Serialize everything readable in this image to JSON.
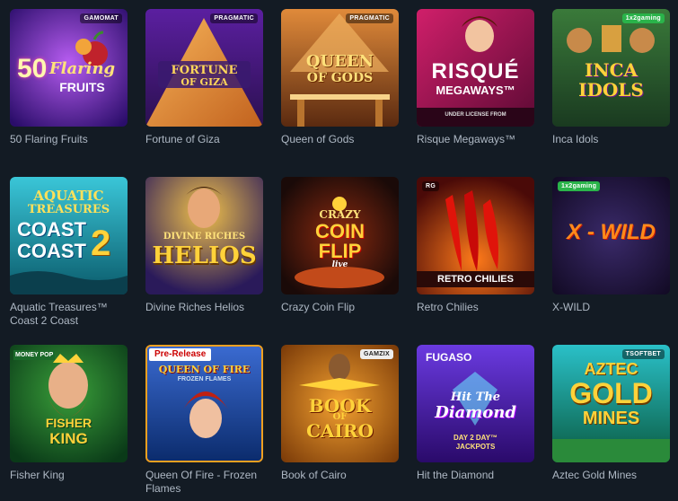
{
  "games": [
    {
      "title": "50 Flaring Fruits",
      "art_text": [
        "50",
        "Flaring",
        "FRUITS"
      ],
      "provider": "GAMOMAT",
      "icon": "fruit-icon"
    },
    {
      "title": "Fortune of Giza",
      "art_text": [
        "FORTUNE",
        "OF GIZA"
      ],
      "provider": "PRAGMATIC",
      "icon": "pyramid-icon"
    },
    {
      "title": "Queen of Gods",
      "art_text": [
        "QUEEN",
        "OF GODS"
      ],
      "provider": "PRAGMATIC",
      "icon": "temple-icon"
    },
    {
      "title": "Risque Megaways™",
      "art_text": [
        "RISQUÉ",
        "MEGAWAYS™",
        "UNDER LICENSE FROM"
      ],
      "provider": "",
      "icon": "dancer-icon"
    },
    {
      "title": "Inca Idols",
      "art_text": [
        "INCA",
        "IDOLS"
      ],
      "provider": "1x2gaming",
      "icon": "idol-icon"
    },
    {
      "title": "Aquatic Treasures™ Coast 2 Coast",
      "art_text": [
        "AQUATIC",
        "TREASURES",
        "COAST",
        "COAST",
        "2"
      ],
      "provider": "",
      "icon": "wave-icon"
    },
    {
      "title": "Divine Riches Helios",
      "art_text": [
        "DIVINE RICHES",
        "HELIOS"
      ],
      "provider": "",
      "icon": "sun-god-icon"
    },
    {
      "title": "Crazy Coin Flip",
      "art_text": [
        "CRAZY",
        "COIN",
        "FLIP",
        "live"
      ],
      "provider": "",
      "icon": "coin-icon"
    },
    {
      "title": "Retro Chilies",
      "art_text": [
        "RETRO CHILIES"
      ],
      "provider": "RG",
      "icon": "chili-icon"
    },
    {
      "title": "X-WILD",
      "art_text": [
        "X - WILD"
      ],
      "provider": "1x2gaming",
      "icon": "x-icon"
    },
    {
      "title": "Fisher King",
      "art_text": [
        "FISHER",
        "KING",
        "MONEY POP"
      ],
      "provider": "",
      "icon": "king-icon"
    },
    {
      "title": "Queen Of Fire - Frozen Flames",
      "art_text": [
        "Pre-Release",
        "QUEEN OF FIRE",
        "FROZEN FLAMES"
      ],
      "provider": "",
      "icon": "queen-icon"
    },
    {
      "title": "Book of Cairo",
      "art_text": [
        "BOOK",
        "OF",
        "CAIRO"
      ],
      "provider": "GAMZIX",
      "icon": "book-icon"
    },
    {
      "title": "Hit the Diamond",
      "art_text": [
        "FUGASO",
        "Hit The",
        "Diamond",
        "DAY 2 DAY™",
        "JACKPOTS"
      ],
      "provider": "",
      "icon": "diamond-icon"
    },
    {
      "title": "Aztec Gold Mines",
      "art_text": [
        "AZTEC",
        "GOLD",
        "MINES"
      ],
      "provider": "TSOFTBET",
      "icon": "mine-icon"
    }
  ],
  "colors": {
    "background": "#131b24",
    "title_text": "#aeb8c4"
  }
}
